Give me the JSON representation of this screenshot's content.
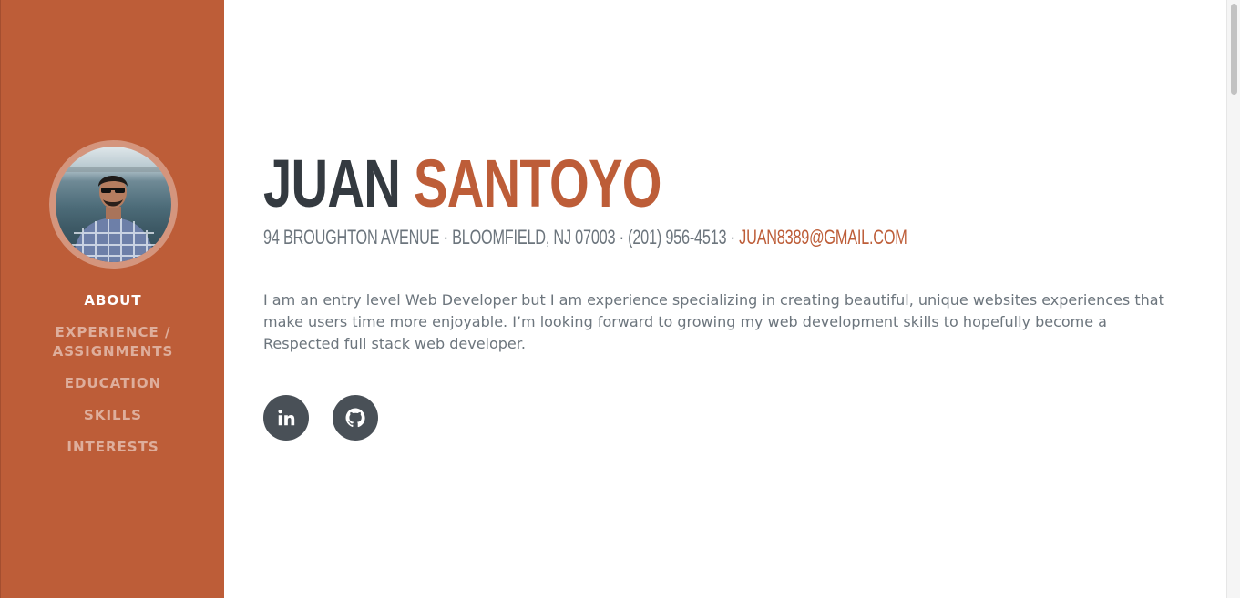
{
  "profile": {
    "first_name": "JUAN",
    "last_name": "SANTOYO",
    "address": "94 BROUGHTON AVENUE · BLOOMFIELD, NJ 07003 · (201) 956-4513 ·",
    "email": "JUAN8389@GMAIL.COM",
    "bio": "I am an entry level Web Developer but I am experience specializing in creating beautiful, unique websites experiences that make users time more enjoyable. I’m looking forward to growing my web development skills to hopefully become a Respected full stack web developer."
  },
  "nav": {
    "items": [
      {
        "label": "ABOUT",
        "active": true
      },
      {
        "label": "EXPERIENCE / ASSIGNMENTS",
        "active": false
      },
      {
        "label": "EDUCATION",
        "active": false
      },
      {
        "label": "SKILLS",
        "active": false
      },
      {
        "label": "INTERESTS",
        "active": false
      }
    ]
  },
  "socials": [
    {
      "icon": "linkedin-icon"
    },
    {
      "icon": "github-icon"
    }
  ],
  "colors": {
    "accent": "#bd5d38",
    "dark": "#343a40",
    "muted": "#6c757d",
    "icon_bg": "#495057"
  }
}
